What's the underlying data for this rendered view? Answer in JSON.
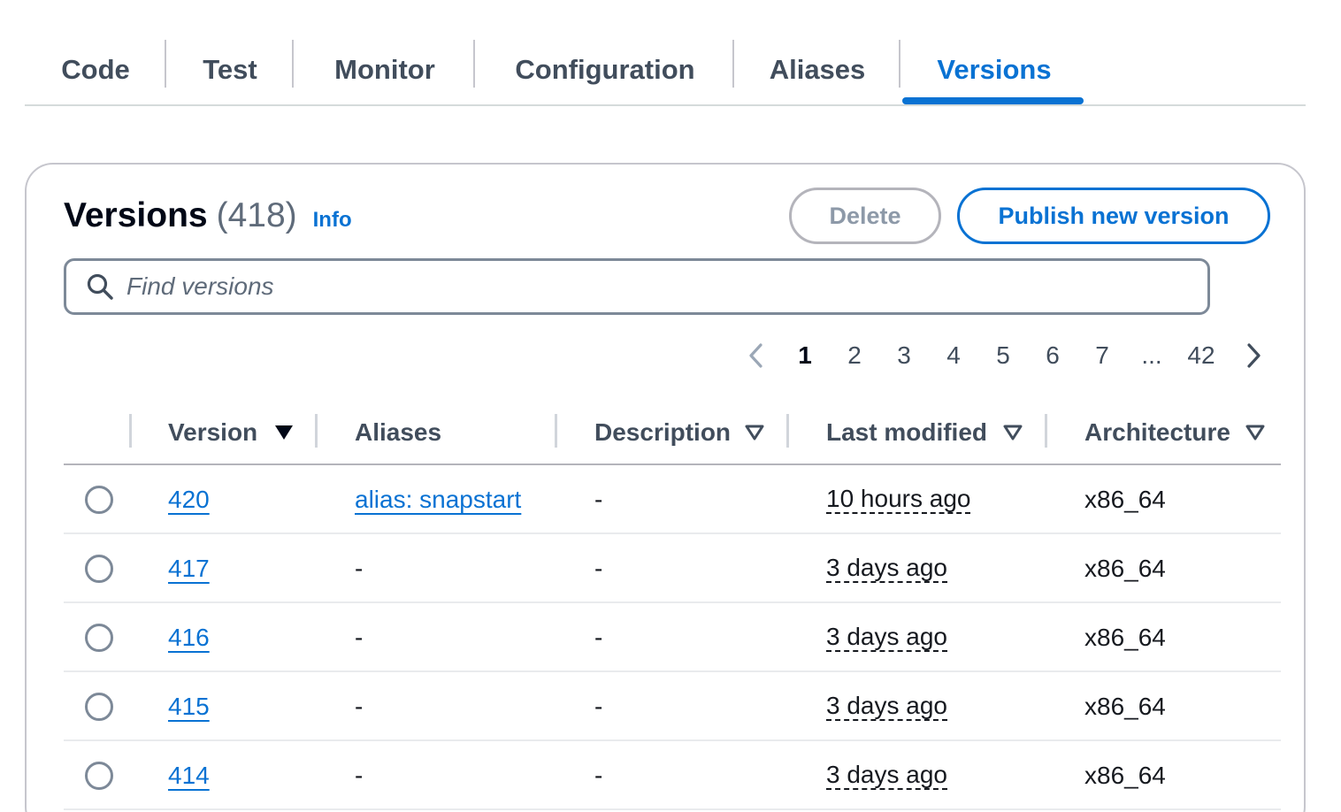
{
  "tabs": [
    "Code",
    "Test",
    "Monitor",
    "Configuration",
    "Aliases",
    "Versions"
  ],
  "active_tab": "Versions",
  "header": {
    "title": "Versions",
    "count": "(418)",
    "info_label": "Info"
  },
  "buttons": {
    "delete_label": "Delete",
    "publish_label": "Publish new version"
  },
  "search": {
    "placeholder": "Find versions"
  },
  "pagination": {
    "pages": [
      "1",
      "2",
      "3",
      "4",
      "5",
      "6",
      "7",
      "...",
      "42"
    ],
    "current": "1"
  },
  "table": {
    "columns": [
      "Version",
      "Aliases",
      "Description",
      "Last modified",
      "Architecture"
    ],
    "rows": [
      {
        "version": "420",
        "aliases": "alias: snapstart",
        "description": "-",
        "last_modified": "10 hours ago",
        "architecture": "x86_64"
      },
      {
        "version": "417",
        "aliases": "-",
        "description": "-",
        "last_modified": "3 days ago",
        "architecture": "x86_64"
      },
      {
        "version": "416",
        "aliases": "-",
        "description": "-",
        "last_modified": "3 days ago",
        "architecture": "x86_64"
      },
      {
        "version": "415",
        "aliases": "-",
        "description": "-",
        "last_modified": "3 days ago",
        "architecture": "x86_64"
      },
      {
        "version": "414",
        "aliases": "-",
        "description": "-",
        "last_modified": "3 days ago",
        "architecture": "x86_64"
      }
    ]
  },
  "colors": {
    "accent": "#0972d3",
    "text": "#16191f",
    "muted": "#5f6b7a"
  }
}
